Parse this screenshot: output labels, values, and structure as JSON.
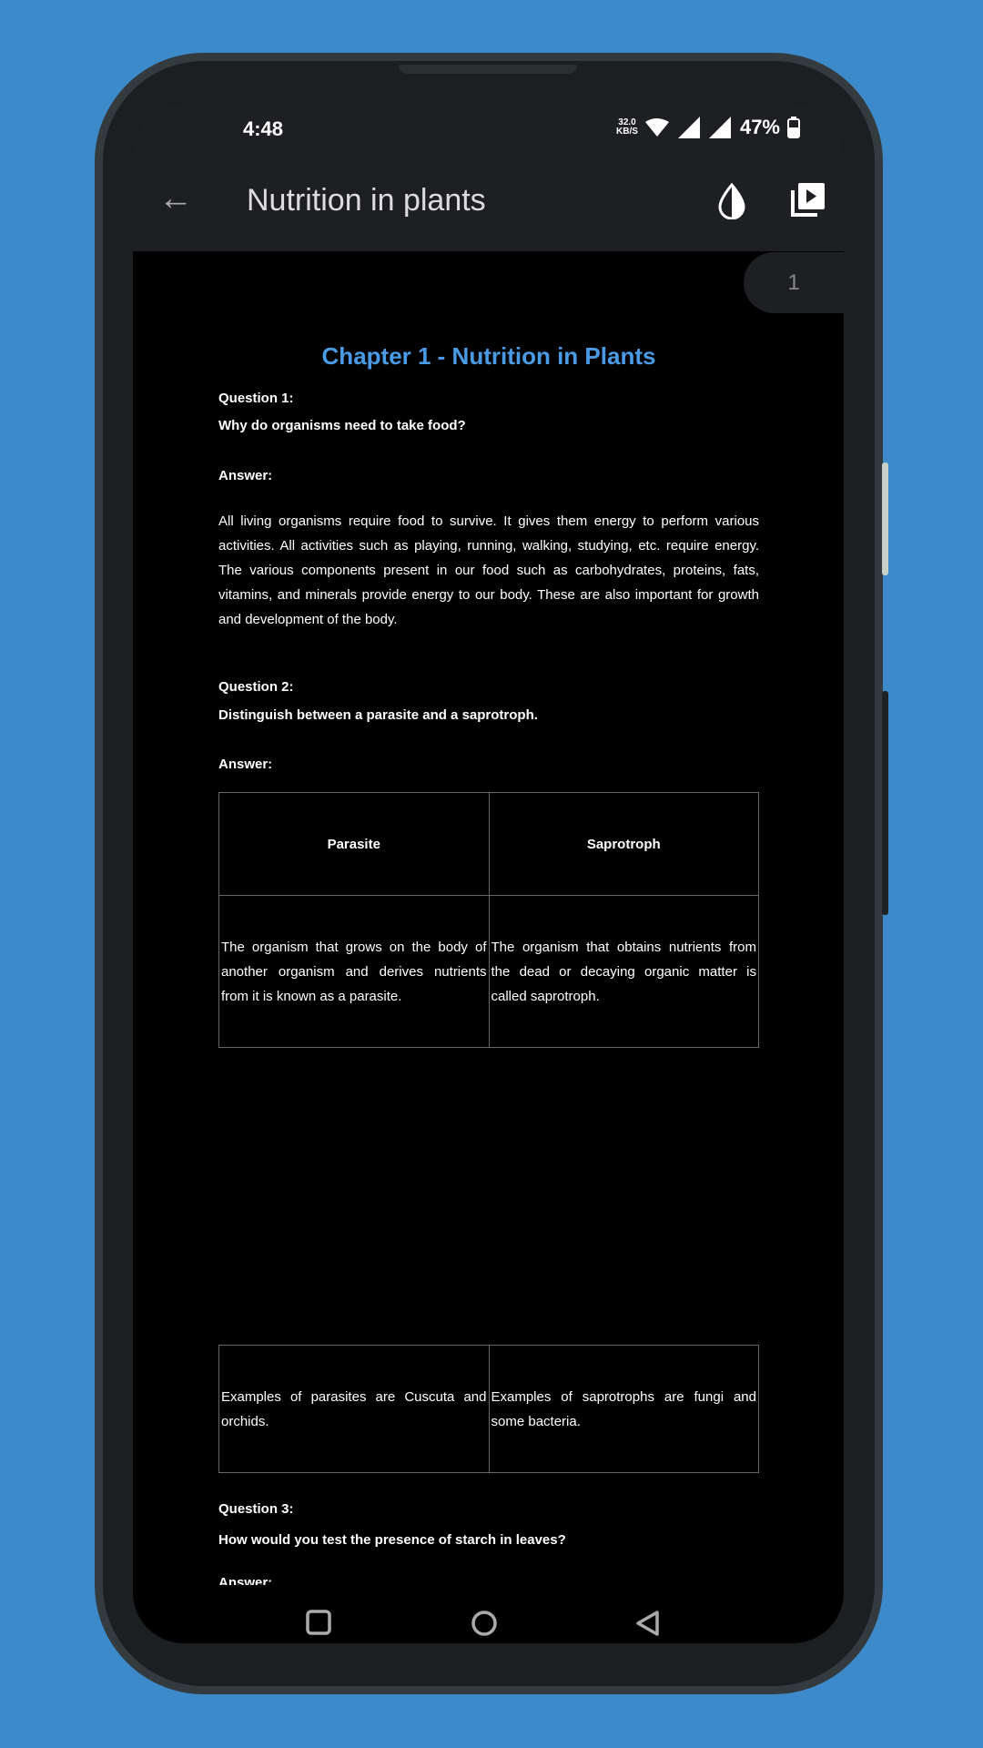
{
  "status_bar": {
    "time": "4:48",
    "net_speed_value": "32.0",
    "net_speed_unit": "KB/S",
    "battery": "47%"
  },
  "app_bar": {
    "title": "Nutrition in plants",
    "back_icon": "arrow-left-icon",
    "icons": [
      "invert-colors-icon",
      "slideshow-icon"
    ]
  },
  "page_indicator": "1",
  "document": {
    "title": "Chapter 1 - Nutrition in Plants",
    "q1": {
      "label": "Question 1:",
      "question": "Why do organisms need to take food?",
      "answer_label": "Answer:",
      "answer": "All living organisms require food to survive. It gives them energy to perform various activities. All activities such as playing, running, walking, studying, etc. require energy. The various components present in our food such as carbohydrates, proteins, fats, vitamins, and minerals provide energy to our body. These are also important for growth and development of the body."
    },
    "q2": {
      "label": "Question 2:",
      "question": "Distinguish between a parasite and a saprotroph.",
      "answer_label": "Answer:",
      "table": {
        "headers": [
          "Parasite",
          "Saprotroph"
        ],
        "rows": [
          [
            "The organism that grows on the body of another organism and derives nutrients from it is known as a parasite.",
            "The organism that obtains nutrients from the dead or decaying organic matter is called saprotroph."
          ],
          [
            "Examples of parasites are Cuscuta and orchids.",
            "Examples of saprotrophs are fungi and some bacteria."
          ]
        ]
      }
    },
    "q3": {
      "label": "Question 3:",
      "question": "How would you test the presence of starch in leaves?",
      "answer_label": "Answer:"
    }
  },
  "colors": {
    "accent": "#4a9be6",
    "background": "#3d8acb",
    "appbar": "#1e1f23"
  },
  "nav_bar": [
    "recents-square-icon",
    "home-circle-icon",
    "back-triangle-icon"
  ]
}
